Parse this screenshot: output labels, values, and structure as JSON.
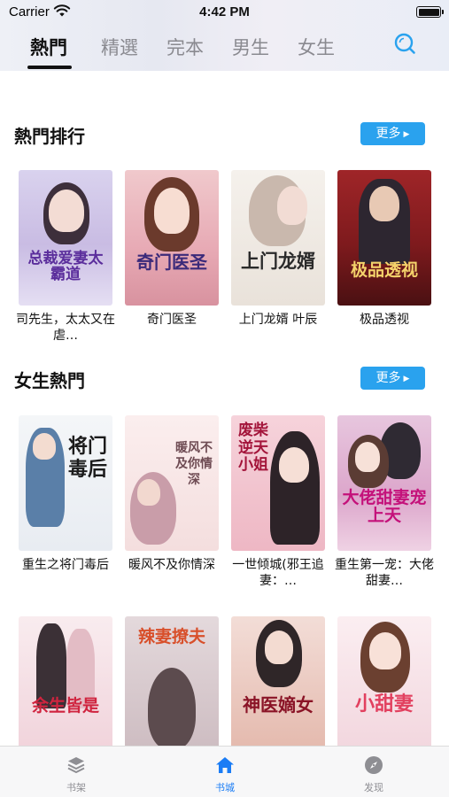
{
  "status_bar": {
    "carrier": "Carrier",
    "time": "4:42 PM"
  },
  "top_tabs": [
    {
      "label": "熱門",
      "active": true
    },
    {
      "label": "精選",
      "active": false
    },
    {
      "label": "完本",
      "active": false
    },
    {
      "label": "男生",
      "active": false
    },
    {
      "label": "女生",
      "active": false
    }
  ],
  "sections": [
    {
      "title": "熱門排行",
      "more_label": "更多",
      "books": [
        {
          "title": "司先生，太太又在虐…",
          "cover_text": "总裁爱妻太霸道",
          "cover_color": "#cfc6e6"
        },
        {
          "title": "奇门医圣",
          "cover_text": "奇门医圣",
          "cover_color": "#e8a9b3"
        },
        {
          "title": "上门龙婿 叶辰",
          "cover_text": "上门龙婿",
          "cover_color": "#f1ece7"
        },
        {
          "title": "极品透视",
          "cover_text": "极品透视",
          "cover_color": "#8d1f22"
        }
      ]
    },
    {
      "title": "女生熱門",
      "more_label": "更多",
      "books": [
        {
          "title": "重生之将门毒后",
          "cover_text": "将门毒后",
          "cover_color": "#eef1f5"
        },
        {
          "title": "暖风不及你情深",
          "cover_text": "暖风不及你情深",
          "cover_color": "#f6e6e6"
        },
        {
          "title": "一世倾城(邪王追妻：…",
          "cover_text": "废柴逆天小姐",
          "cover_color": "#f2c9d3"
        },
        {
          "title": "重生第一宠：大佬甜妻…",
          "cover_text": "大佬甜妻宠上天",
          "cover_color": "#e4b8d6"
        }
      ]
    },
    {
      "title": "",
      "more_label": "",
      "books": [
        {
          "title": "",
          "cover_text": "余生皆是",
          "cover_color": "#f4dde2"
        },
        {
          "title": "",
          "cover_text": "辣妻撩夫",
          "cover_color": "#d9ccd0"
        },
        {
          "title": "",
          "cover_text": "神医嫡女",
          "cover_color": "#e9c8c0"
        },
        {
          "title": "",
          "cover_text": "小甜妻",
          "cover_color": "#f6dfe4"
        }
      ]
    }
  ],
  "tab_bar": [
    {
      "label": "书架",
      "icon": "layers-icon",
      "active": false
    },
    {
      "label": "书城",
      "icon": "home-icon",
      "active": true
    },
    {
      "label": "发现",
      "icon": "compass-icon",
      "active": false
    }
  ],
  "colors": {
    "accent": "#2aa2ee",
    "tab_active": "#1a7cf5",
    "search_icon": "#2aa2ee"
  }
}
